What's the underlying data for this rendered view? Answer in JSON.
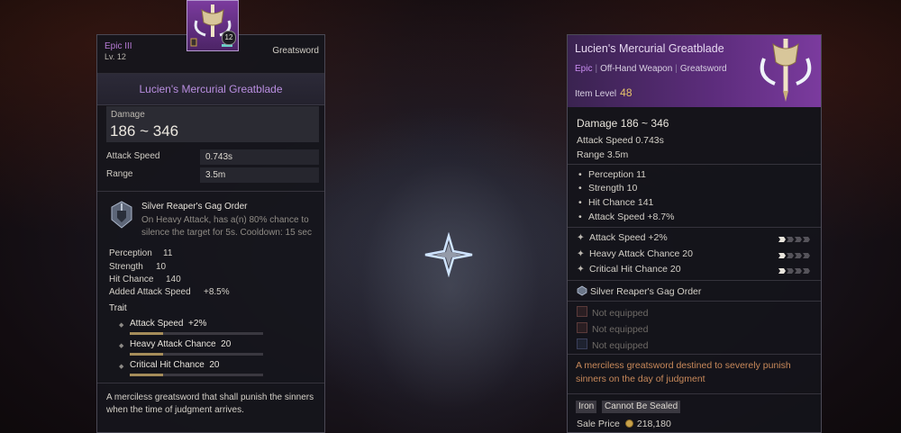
{
  "left_panel": {
    "rarity": "Epic III",
    "level": "Lv. 12",
    "category": "Greatsword",
    "item_badge": "12",
    "title": "Lucien's Mercurial Greatblade",
    "damage_label": "Damage",
    "damage_value": "186 ~ 346",
    "rows": [
      {
        "label": "Attack Speed",
        "value": "0.743s"
      },
      {
        "label": "Range",
        "value": "3.5m"
      }
    ],
    "skill": {
      "name": "Silver Reaper's Gag Order",
      "description": "On Heavy Attack, has a(n) 80% chance to silence the target for 5s. Cooldown: 15 sec"
    },
    "stats": [
      {
        "label": "Perception",
        "value": "11"
      },
      {
        "label": "Strength",
        "value": "10"
      },
      {
        "label": "Hit Chance",
        "value": "140"
      },
      {
        "label": "Added Attack Speed",
        "value": "+8.5%"
      }
    ],
    "trait_heading": "Trait",
    "traits": [
      {
        "name": "Attack Speed",
        "value": "+2%",
        "progress": 0.25
      },
      {
        "name": "Heavy Attack Chance",
        "value": "20",
        "progress": 0.25
      },
      {
        "name": "Critical Hit Chance",
        "value": "20",
        "progress": 0.25
      }
    ],
    "lore": "A merciless greatsword that shall punish the sinners when the time of judgment arrives."
  },
  "right_panel": {
    "title": "Lucien's Mercurial Greatblade",
    "rarity": "Epic",
    "slot_type": "Off-Hand Weapon",
    "weapon_type": "Greatsword",
    "item_level_label": "Item Level",
    "item_level": "48",
    "damage": "Damage 186 ~ 346",
    "attack_speed": "Attack Speed 0.743s",
    "range": "Range 3.5m",
    "bullets": [
      "Perception 11",
      "Strength 10",
      "Hit Chance 141",
      "Attack Speed +8.7%"
    ],
    "traits": [
      {
        "text": "Attack Speed +2%",
        "pips_filled": 1,
        "pips_total": 4
      },
      {
        "text": "Heavy Attack Chance 20",
        "pips_filled": 1,
        "pips_total": 4
      },
      {
        "text": "Critical Hit Chance 20",
        "pips_filled": 1,
        "pips_total": 4
      }
    ],
    "set_name": "Silver Reaper's Gag Order",
    "slots": [
      "Not equipped",
      "Not equipped",
      "Not equipped"
    ],
    "lore": "A merciless greatsword destined to severely punish sinners on the day of judgment",
    "tags": [
      "Iron",
      "Cannot Be Sealed"
    ],
    "sale_price_label": "Sale Price",
    "sale_price": "218,180"
  },
  "colors": {
    "epic_purple": "#7b3b9e",
    "title_purple": "#b98ee0",
    "item_level_gold": "#e6c36a",
    "lore_orange": "#c8895a"
  }
}
